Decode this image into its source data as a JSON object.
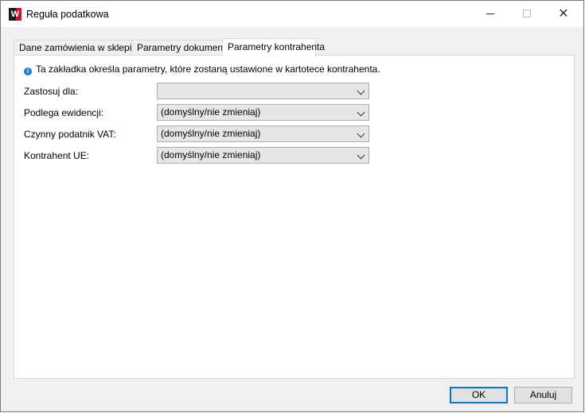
{
  "window": {
    "title": "Reguła podatkowa",
    "app_icon_letter": "W"
  },
  "tabs": [
    {
      "label": "Dane zamówienia w sklepie",
      "active": false
    },
    {
      "label": "Parametry dokumentu",
      "active": false
    },
    {
      "label": "Parametry kontrahenta",
      "active": true
    }
  ],
  "panel": {
    "info": "Ta zakładka określa parametry, które zostaną ustawione w kartotece kontrahenta.",
    "fields": [
      {
        "label": "Zastosuj dla:",
        "value": ""
      },
      {
        "label": "Podlega ewidencji:",
        "value": "(domyślny/nie zmieniaj)"
      },
      {
        "label": "Czynny podatnik VAT:",
        "value": "(domyślny/nie zmieniaj)"
      },
      {
        "label": "Kontrahent UE:",
        "value": "(domyślny/nie zmieniaj)"
      }
    ]
  },
  "buttons": {
    "ok": "OK",
    "cancel": "Anuluj"
  },
  "colors": {
    "accent": "#0078d7",
    "info_icon": "#1e7bd6",
    "app_icon": "#c8102e"
  }
}
